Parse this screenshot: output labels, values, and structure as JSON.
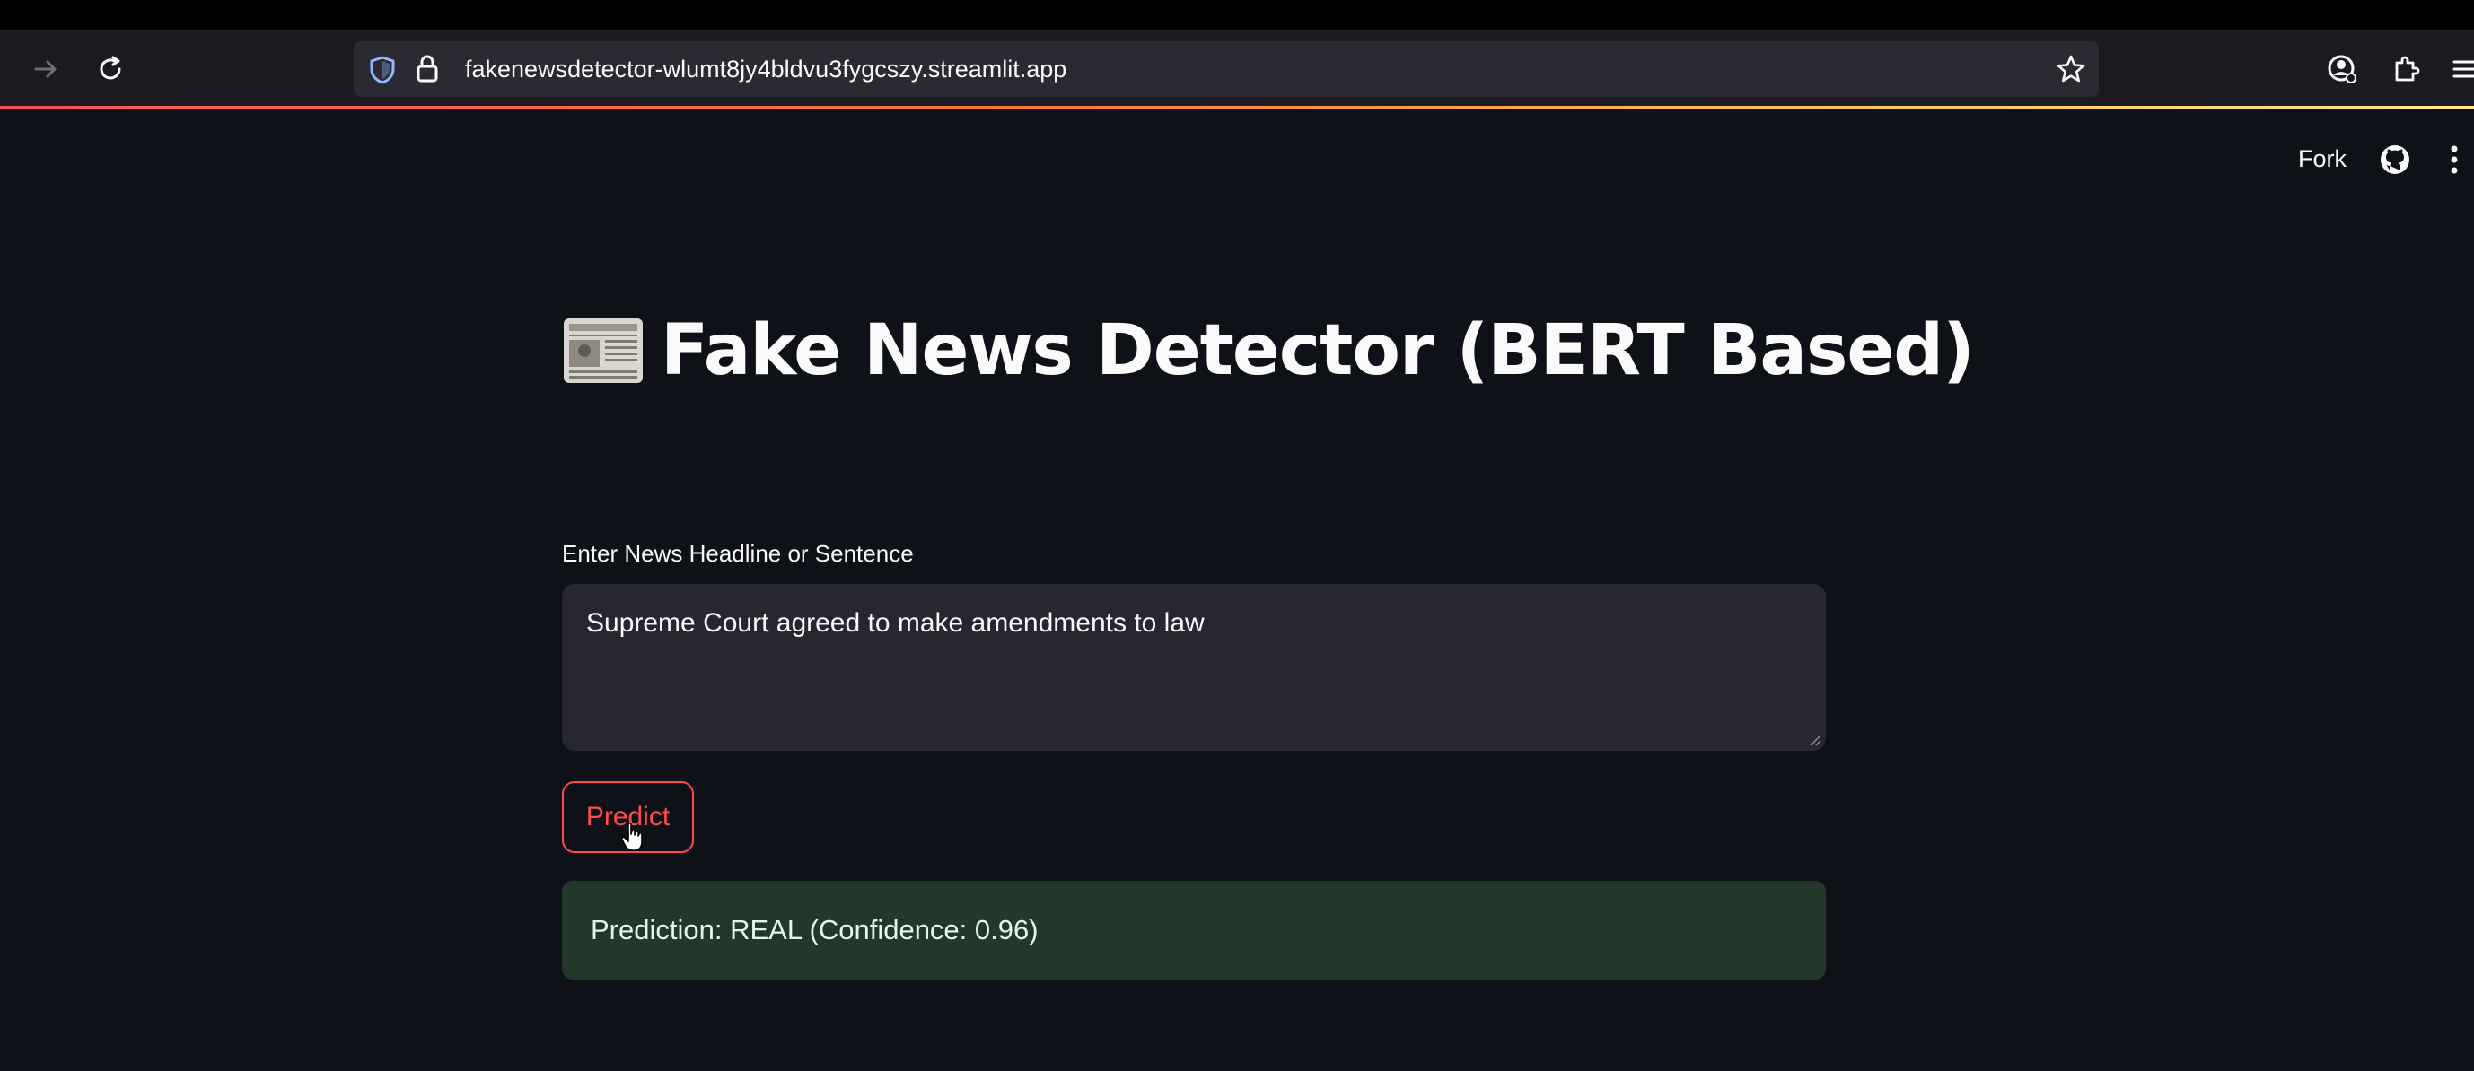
{
  "browser": {
    "url": "fakenewsdetector-wlumt8jy4bldvu3fygcszy.streamlit.app"
  },
  "app_header": {
    "fork_label": "Fork"
  },
  "main": {
    "title": "Fake News Detector (BERT Based)",
    "input_label": "Enter News Headline or Sentence",
    "input_value": "Supreme Court agreed to make amendments to law",
    "predict_label": "Predict",
    "result_text": "Prediction: REAL (Confidence: 0.96)"
  },
  "colors": {
    "background": "#0e1117",
    "primary": "#ff4b4b",
    "success_bg": "#21382b",
    "input_bg": "#262730"
  }
}
